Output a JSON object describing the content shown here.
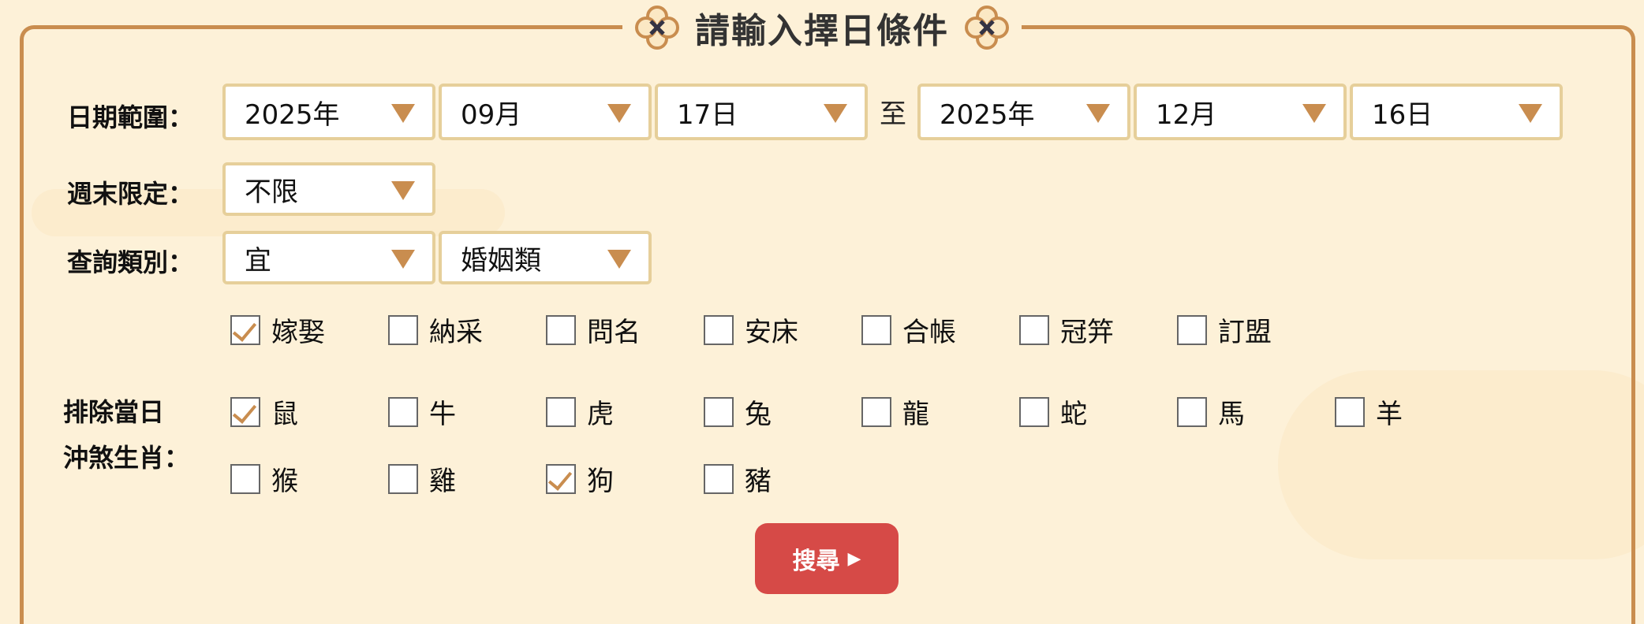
{
  "title": "請輸入擇日條件",
  "ornament_icon": "flower-quatrefoil-icon",
  "date_range": {
    "label": "日期範圍：",
    "start": {
      "year": "2025年",
      "month": "09月",
      "day": "17日"
    },
    "separator": "至",
    "end": {
      "year": "2025年",
      "month": "12月",
      "day": "16日"
    }
  },
  "weekend": {
    "label": "週末限定：",
    "value": "不限"
  },
  "query": {
    "label": "查詢類別：",
    "type": "宜",
    "category": "婚姻類"
  },
  "activities": [
    {
      "label": "嫁娶",
      "checked": true
    },
    {
      "label": "納采",
      "checked": false
    },
    {
      "label": "問名",
      "checked": false
    },
    {
      "label": "安床",
      "checked": false
    },
    {
      "label": "合帳",
      "checked": false
    },
    {
      "label": "冠笄",
      "checked": false
    },
    {
      "label": "訂盟",
      "checked": false
    }
  ],
  "zodiac": {
    "label_line1": "排除當日",
    "label_line2": "沖煞生肖：",
    "items": [
      {
        "label": "鼠",
        "checked": true
      },
      {
        "label": "牛",
        "checked": false
      },
      {
        "label": "虎",
        "checked": false
      },
      {
        "label": "兔",
        "checked": false
      },
      {
        "label": "龍",
        "checked": false
      },
      {
        "label": "蛇",
        "checked": false
      },
      {
        "label": "馬",
        "checked": false
      },
      {
        "label": "羊",
        "checked": false
      },
      {
        "label": "猴",
        "checked": false
      },
      {
        "label": "雞",
        "checked": false
      },
      {
        "label": "狗",
        "checked": true
      },
      {
        "label": "豬",
        "checked": false
      }
    ]
  },
  "search_button": {
    "label": "搜尋",
    "icon": "play-triangle-icon"
  },
  "colors": {
    "accent": "#c98d4f",
    "button": "#d64a47",
    "background": "#fdf1d8",
    "select_border": "#e6cf9a"
  }
}
